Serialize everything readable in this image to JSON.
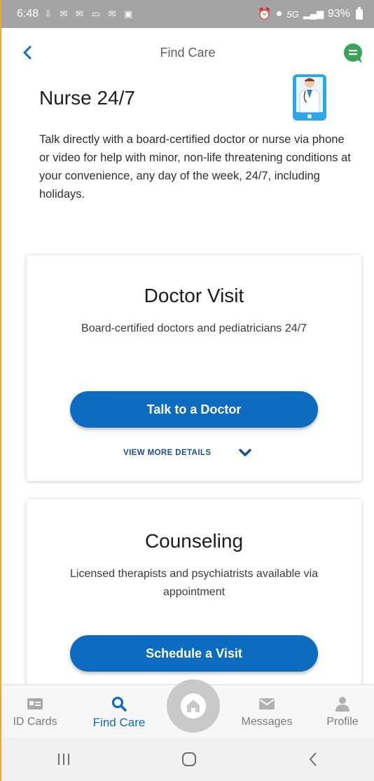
{
  "status_bar": {
    "time": "6:48",
    "network": "5G",
    "battery": "93%",
    "left_icons": [
      "download-icon",
      "mail-icon",
      "message-icon",
      "mail-icon",
      "calendar-icon",
      "image-icon"
    ]
  },
  "header": {
    "title": "Find Care",
    "back_icon": "chevron-left-icon",
    "chat_icon": "chat-bubble-icon"
  },
  "page": {
    "heading": "Nurse 24/7",
    "description": "Talk directly with a board-certified doctor or nurse via phone or video for help with minor, non-life threatening conditions at your convenience, any day of the week, 24/7, including holidays."
  },
  "cards": [
    {
      "title": "Doctor Visit",
      "description": "Board-certified doctors and pediatricians 24/7",
      "button_label": "Talk to a Doctor",
      "details_label": "VIEW MORE DETAILS"
    },
    {
      "title": "Counseling",
      "description": "Licensed therapists and psychiatrists available via appointment",
      "button_label": "Schedule a Visit"
    }
  ],
  "bottom_nav": {
    "items": [
      {
        "label": "ID Cards",
        "icon": "id-card-icon"
      },
      {
        "label": "Find Care",
        "icon": "search-icon",
        "active": true
      },
      {
        "label": "",
        "icon": "home-icon"
      },
      {
        "label": "Messages",
        "icon": "envelope-icon"
      },
      {
        "label": "Profile",
        "icon": "person-icon"
      }
    ]
  },
  "system_nav": [
    "recent-apps-icon",
    "home-button-icon",
    "back-icon"
  ],
  "colors": {
    "brand_blue": "#0d6cc0",
    "link_blue": "#1b4f89",
    "chat_green": "#3aa35a",
    "status_bar_gray": "#a4a4a4"
  }
}
